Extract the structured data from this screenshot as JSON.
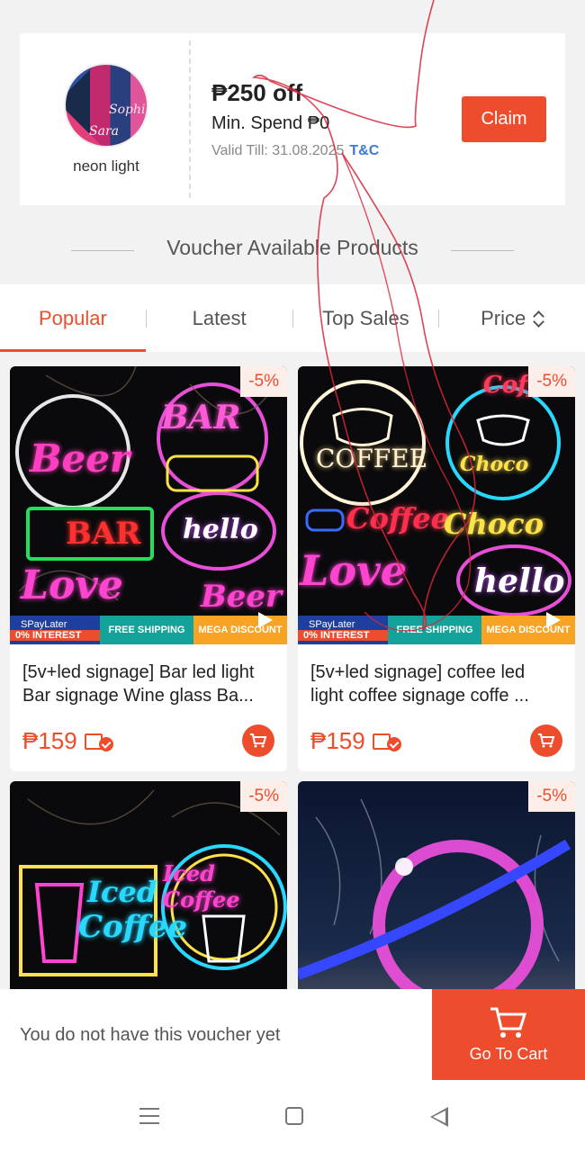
{
  "voucher": {
    "shop_name": "neon light",
    "amount": "₱250 off",
    "min_spend": "Min. Spend ₱0",
    "valid_till": "Valid Till: 31.08.2025",
    "tc_label": "T&C",
    "claim_label": "Claim"
  },
  "section": {
    "title": "Voucher Available Products"
  },
  "tabs": [
    {
      "label": "Popular",
      "active": true
    },
    {
      "label": "Latest"
    },
    {
      "label": "Top Sales"
    },
    {
      "label": "Price"
    }
  ],
  "banner": {
    "spaylater": "SPayLater",
    "interest": "0% INTEREST",
    "free_shipping": "FREE SHIPPING",
    "mega_discount": "MEGA DISCOUNT"
  },
  "products": [
    {
      "discount": "-5%",
      "name_line1": "[5v+led signage] Bar led light",
      "name_line2": "Bar signage Wine glass Ba...",
      "price": "₱159",
      "signs": [
        "Beer",
        "BAR",
        "BAR",
        "hello",
        "Love",
        "Beer"
      ]
    },
    {
      "discount": "-5%",
      "name_line1": "[5v+led signage] coffee led",
      "name_line2": "light coffee signage coffe ...",
      "price": "₱159",
      "signs": [
        "COFFEE",
        "Coffee",
        "Choco",
        "Coffee",
        "Choco",
        "Love",
        "hello"
      ]
    },
    {
      "discount": "-5%",
      "signs": [
        "Iced",
        "Coffee",
        "Iced Coffee"
      ]
    },
    {
      "discount": "-5%"
    }
  ],
  "bottom_bar": {
    "status": "You do not have this voucher yet",
    "go_to_cart": "Go To Cart"
  },
  "colors": {
    "accent": "#ee4d2d",
    "link": "#3d7bd6"
  }
}
